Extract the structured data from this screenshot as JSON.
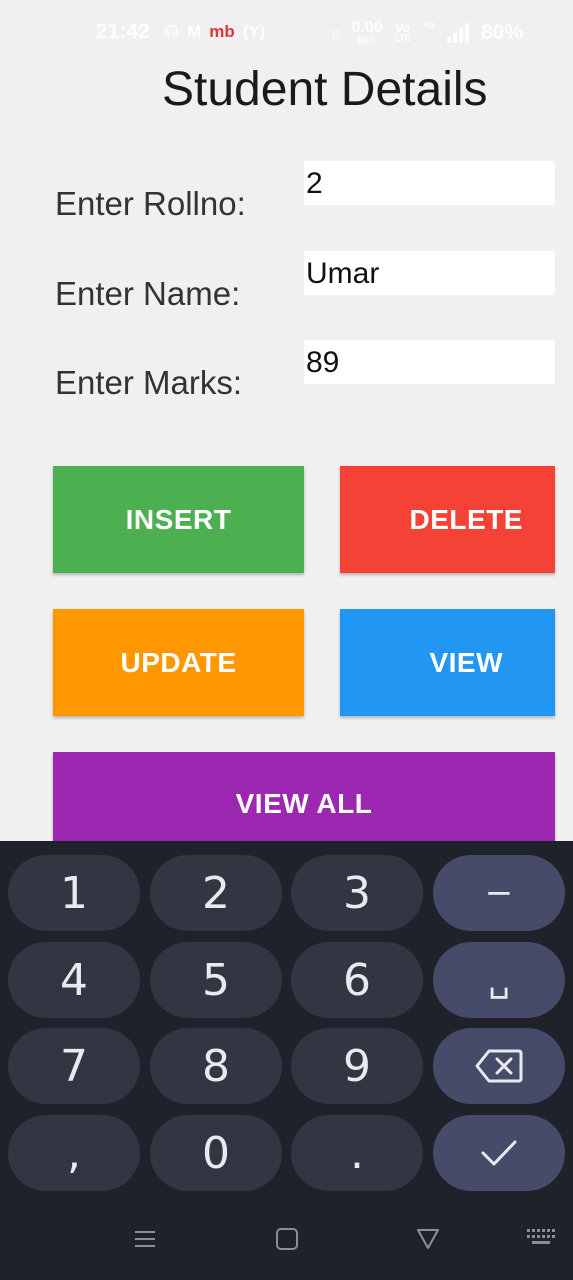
{
  "status_bar": {
    "time": "21:42",
    "carrier": "mb",
    "net_speed": "0.00",
    "net_unit": "KB/S",
    "volte_top": "Vo",
    "volte_bottom": "LTE",
    "network": "4G",
    "battery": "80%"
  },
  "title": "Student Details",
  "form": {
    "rollno_label": "Enter Rollno:",
    "rollno_value": "2",
    "name_label": "Enter Name:",
    "name_value": "Umar",
    "marks_label": "Enter Marks:",
    "marks_value": "89"
  },
  "buttons": {
    "insert": "INSERT",
    "delete": "DELETE",
    "update": "UPDATE",
    "view": "VIEW",
    "view_all": "VIEW ALL"
  },
  "colors": {
    "insert": "#4caf50",
    "delete": "#f44336",
    "update": "#ff9800",
    "view": "#2196f3",
    "view_all": "#9c27b0"
  },
  "keyboard": {
    "keys": [
      "1",
      "2",
      "3",
      "−",
      "4",
      "5",
      "6",
      "␣",
      "7",
      "8",
      "9",
      "⌫",
      ",",
      "0",
      ".",
      "✓"
    ]
  },
  "nav_icons": [
    "menu-icon",
    "home-icon",
    "back-icon",
    "keyboard-icon"
  ]
}
